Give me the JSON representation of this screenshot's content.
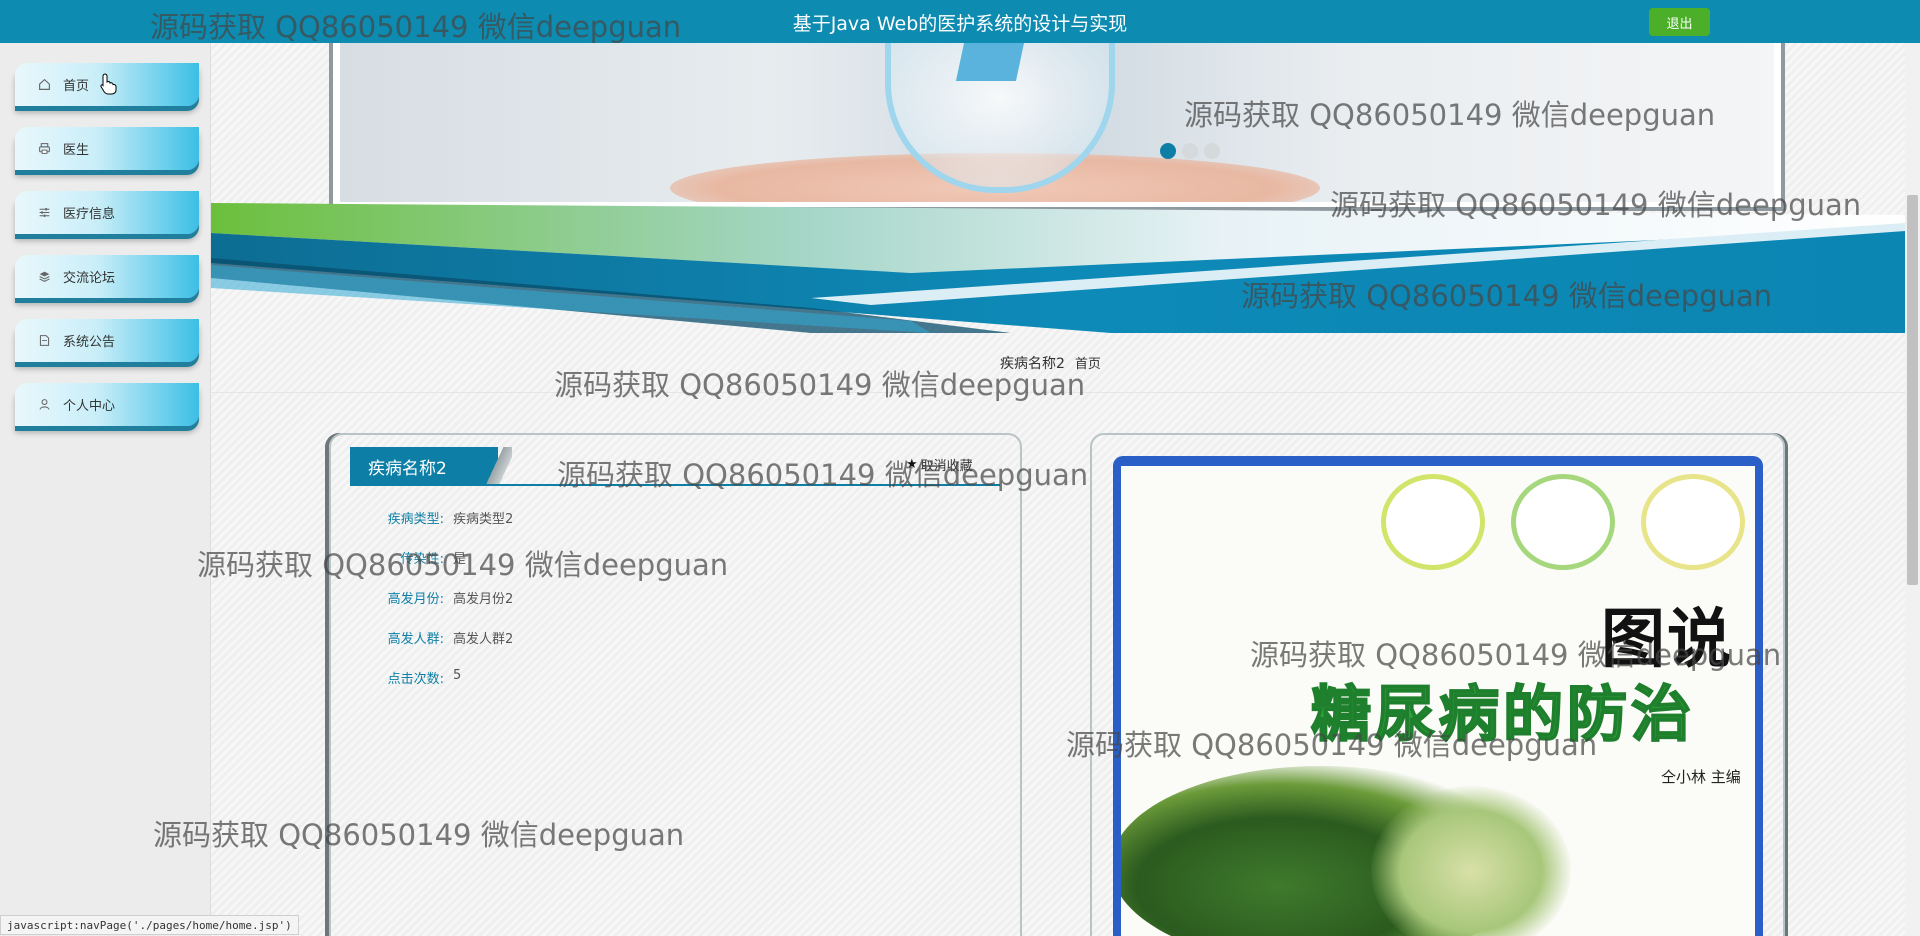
{
  "header": {
    "title": "基于Java Web的医护系统的设计与实现",
    "logout_label": "退出"
  },
  "sidebar": {
    "items": [
      {
        "label": "首页",
        "icon": "home-icon"
      },
      {
        "label": "医生",
        "icon": "printer-icon"
      },
      {
        "label": "医疗信息",
        "icon": "sliders-icon"
      },
      {
        "label": "交流论坛",
        "icon": "layers-icon"
      },
      {
        "label": "系统公告",
        "icon": "document-icon"
      },
      {
        "label": "个人中心",
        "icon": "user-icon"
      }
    ]
  },
  "carousel": {
    "slide_count": 3,
    "active_index": 0
  },
  "breadcrumb": {
    "current": "疾病名称2",
    "home": "首页"
  },
  "detail": {
    "name": "疾病名称2",
    "collect_label": "取消收藏",
    "fields": [
      {
        "label": "疾病类型:",
        "value": "疾病类型2"
      },
      {
        "label": "传染性:",
        "value": "是"
      },
      {
        "label": "高发月份:",
        "value": "高发月份2"
      },
      {
        "label": "高发人群:",
        "value": "高发人群2"
      },
      {
        "label": "点击次数:",
        "value": "5"
      }
    ]
  },
  "book_cover": {
    "title_small": "图说",
    "title_big": "糖尿病的防治",
    "editor": "仝小林 主编"
  },
  "watermark_text": "源码获取 QQ86050149 微信deepguan",
  "status_bar": "javascript:navPage('./pages/home/home.jsp')",
  "colors": {
    "primary": "#0d8bb0",
    "accent_green": "#4caf2a",
    "book_border": "#2a5fc8"
  }
}
